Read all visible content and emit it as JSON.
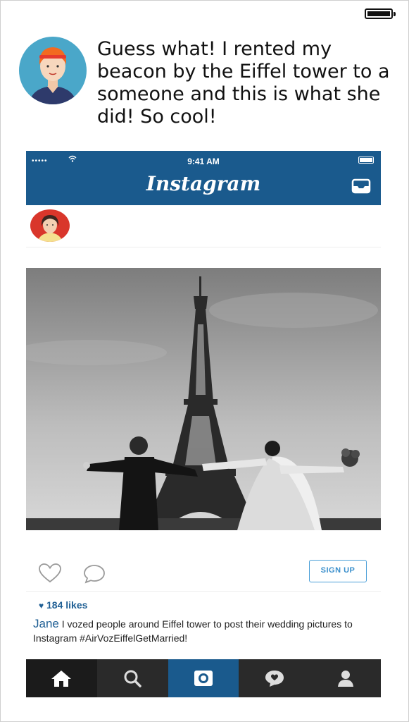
{
  "message": {
    "text": "Guess what! I rented my beacon by the Eiffel tower to a someone and this is what she did! So cool!"
  },
  "instagram": {
    "status_bar": {
      "signal": "•••••",
      "time": "9:41 AM"
    },
    "logo": "Instagram",
    "post": {
      "signup_label": "SIGN UP",
      "likes_heart": "♥",
      "likes": "184 likes",
      "caption_user": "Jane",
      "caption_text": " I vozed people around Eiffel tower to post their wedding pictures to Instagram #AirVozEiffelGetMarried!"
    },
    "tabs": [
      "home-icon",
      "search-icon",
      "camera-icon",
      "activity-icon",
      "profile-icon"
    ]
  },
  "colors": {
    "header_blue": "#1a5a8d",
    "link_blue": "#1f5f94",
    "tabbar": "#1b1b1b",
    "signup_border": "#4a9fd8"
  }
}
